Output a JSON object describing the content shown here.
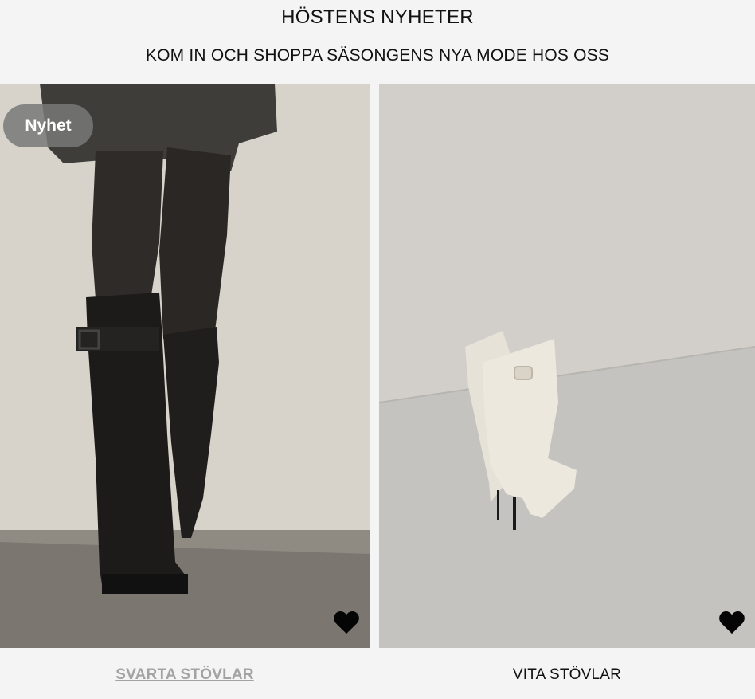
{
  "header": {
    "title": "HÖSTENS NYHETER",
    "subtitle": "KOM IN OCH SHOPPA SÄSONGENS NYA MODE HOS OSS"
  },
  "products": [
    {
      "badge": "Nyhet",
      "caption": "SVARTA STÖVLAR",
      "favorite_icon": "heart-icon"
    },
    {
      "caption": "VITA STÖVLAR",
      "favorite_icon": "heart-icon"
    }
  ],
  "colors": {
    "background": "#f4f4f4",
    "badge_bg": "#7a7a7a",
    "caption_link": "#a3a3a3"
  }
}
